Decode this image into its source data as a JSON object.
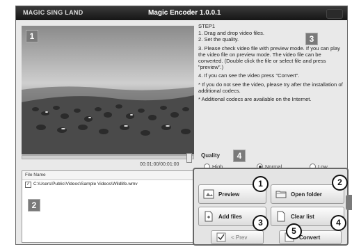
{
  "window": {
    "brand": "MAGIC SING LAND",
    "title": "Magic Encoder 1.0.0.1"
  },
  "badges": {
    "video": "1",
    "filelist": "2",
    "steps": "3",
    "quality": "4"
  },
  "player": {
    "timecode": "00:01:00/00:01:00"
  },
  "file_list": {
    "header": "File Name",
    "rows": [
      {
        "checked": true,
        "path": "C:\\Users\\Public\\Videos\\Sample Videos\\Wildlife.wmv"
      }
    ]
  },
  "steps": {
    "heading": "STEP1",
    "lines": [
      "1. Drag and drop video files.",
      "2. Set the quality.",
      "3. Please check video file with preview mode. If you can play the video file on preview mode. The video file can be converted. (Double click the file or select file and press \"preview\".)",
      "4. If you can see the video press \"Convert\".",
      "* If you do not see the video, please try after the installation of additional codecs.",
      "* Additional codecs are available on the Internet."
    ]
  },
  "quality": {
    "label": "Quality",
    "options": [
      "High",
      "Normal",
      "Low"
    ],
    "selected": "Normal"
  },
  "buttons": {
    "preview": "Preview",
    "open_folder": "Open folder",
    "add_files": "Add files",
    "clear_list": "Clear list",
    "prev": "< Prev",
    "convert": "Convert"
  },
  "callouts": {
    "preview": "1",
    "open_folder": "2",
    "add_files": "3",
    "clear_list": "4",
    "convert": "5"
  }
}
